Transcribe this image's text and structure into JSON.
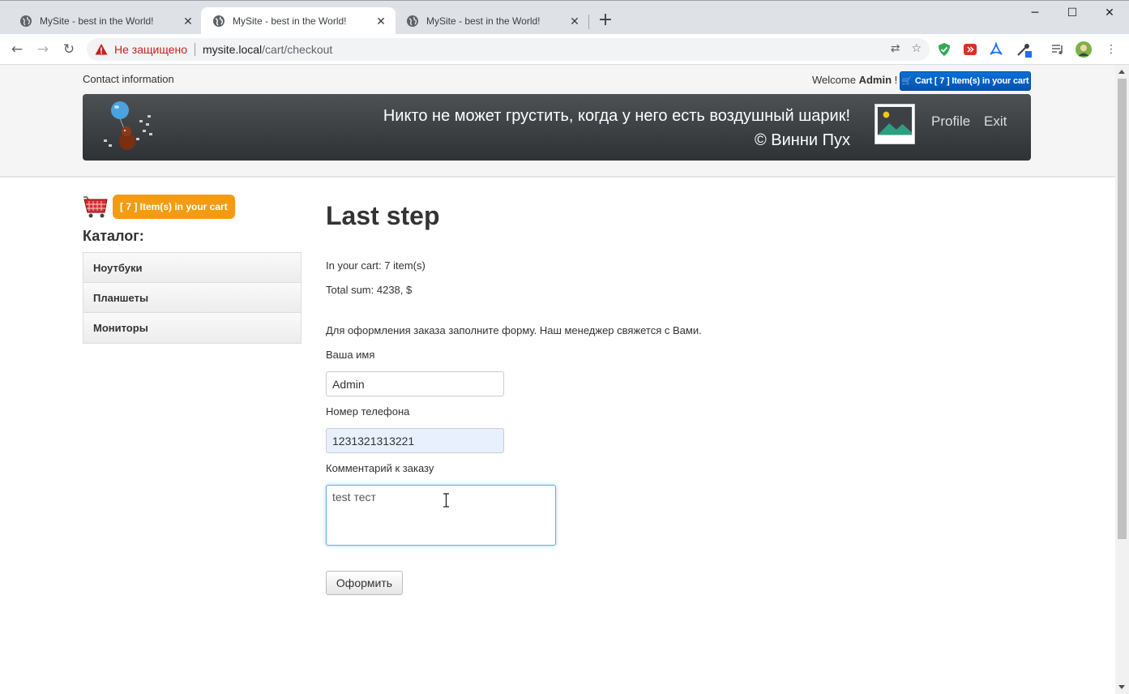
{
  "browser": {
    "tabs": [
      {
        "title": "MySite - best in the World!",
        "active": false
      },
      {
        "title": "MySite - best in the World!",
        "active": true
      },
      {
        "title": "MySite - best in the World!",
        "active": false
      }
    ],
    "security_label": "Не защищено",
    "url_host": "mysite.local",
    "url_path": "/cart/checkout"
  },
  "header": {
    "contact": "Contact information",
    "welcome_prefix": "Welcome",
    "user": "Admin",
    "welcome_suffix": "!",
    "cart_button": "Cart [ 7 ] Item(s) in your cart",
    "quote_line1": "Никто не может грустить, когда у него есть воздушный шарик!",
    "quote_line2": "© Винни Пух",
    "nav_profile": "Profile",
    "nav_exit": "Exit"
  },
  "sidebar": {
    "cart_badge": "[ 7 ] Item(s) in your cart",
    "catalog_title": "Каталог:",
    "items": [
      {
        "label": "Ноутбуки"
      },
      {
        "label": "Планшеты"
      },
      {
        "label": "Мониторы"
      }
    ]
  },
  "main": {
    "title": "Last step",
    "in_cart": "In your cart: 7 item(s)",
    "total": "Total sum: 4238, $",
    "instructions": "Для оформления заказа заполните форму. Наш менеджер свяжется с Вами.",
    "name_label": "Ваша имя",
    "name_value": "Admin",
    "phone_label": "Номер телефона",
    "phone_value": "1231321313221",
    "comment_label": "Комментарий к заказу",
    "comment_value": "test тест",
    "submit_label": "Оформить"
  },
  "colors": {
    "cart_button": "#0a6fd8",
    "orange_badge": "#f39c12",
    "hero_background": "#3a3d40",
    "insecure_text": "#c5221f"
  }
}
